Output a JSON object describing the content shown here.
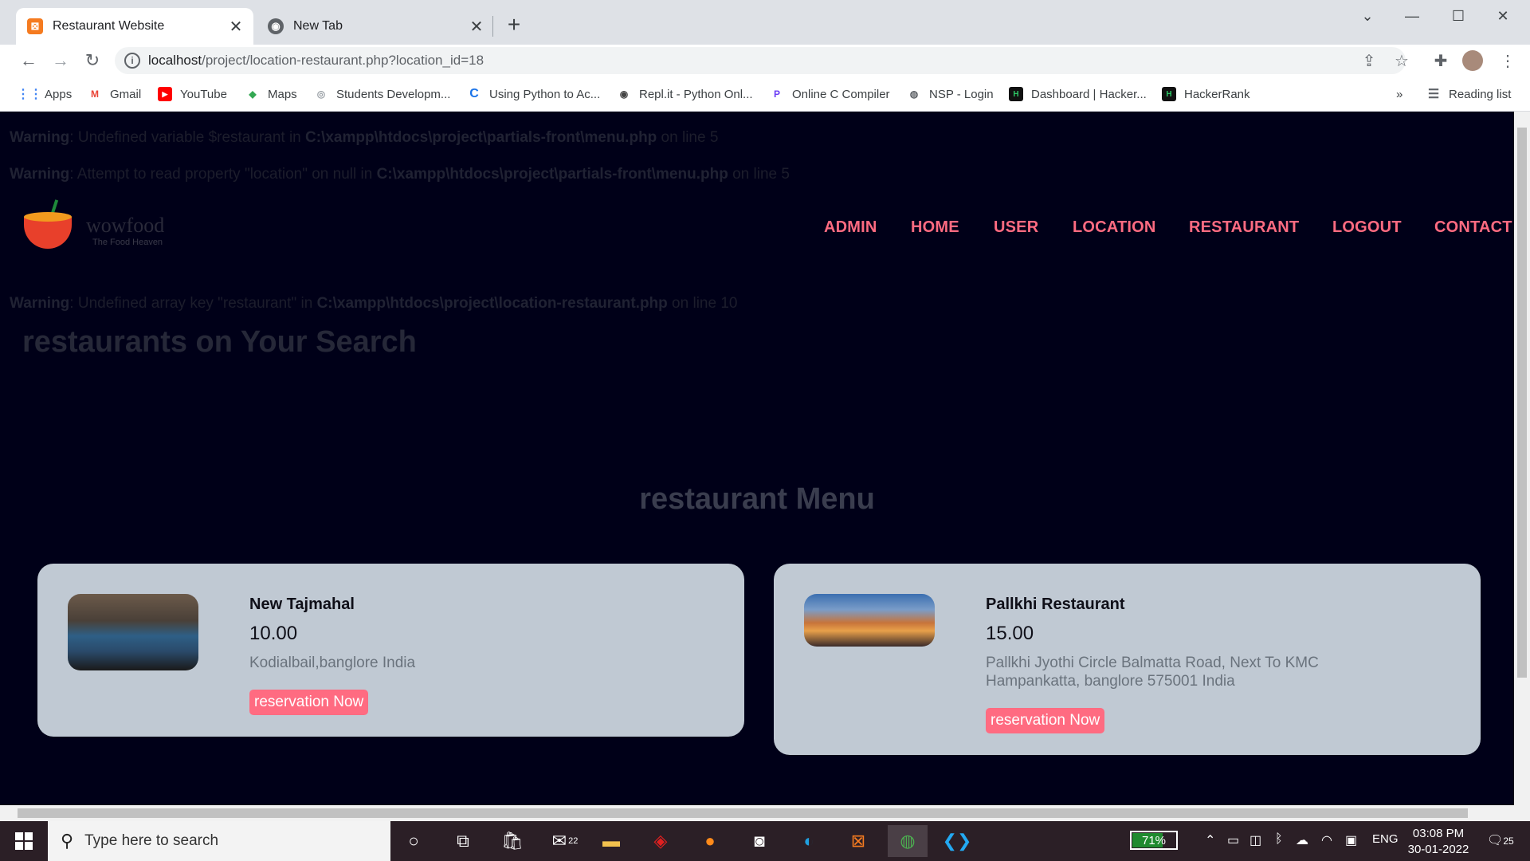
{
  "browser": {
    "tabs": [
      {
        "title": "Restaurant Website",
        "icon": "xampp-icon",
        "active": true
      },
      {
        "title": "New Tab",
        "icon": "globe-icon",
        "active": false
      }
    ],
    "url_host": "localhost",
    "url_path": "/project/location-restaurant.php?location_id=18",
    "bookmarks": [
      "Apps",
      "Gmail",
      "YouTube",
      "Maps",
      "Students Developm...",
      "Using Python to Ac...",
      "Repl.it - Python Onl...",
      "Online C Compiler",
      "NSP - Login",
      "Dashboard | Hacker...",
      "HackerRank"
    ],
    "reading_list": "Reading list",
    "more_bookmarks": "»"
  },
  "page": {
    "logo": {
      "brand": "wowfood",
      "tagline": "The Food Heaven"
    },
    "nav": [
      "ADMIN",
      "HOME",
      "USER",
      "LOCATION",
      "RESTAURANT",
      "LOGOUT",
      "CONTACT"
    ],
    "warnings": [
      {
        "label": "Warning",
        "text": ": Undefined variable $restaurant in ",
        "file": "C:\\xampp\\htdocs\\project\\partials-front\\menu.php",
        "line": " on line 5"
      },
      {
        "label": "Warning",
        "text": ": Attempt to read property \"location\" on null in ",
        "file": "C:\\xampp\\htdocs\\project\\partials-front\\menu.php",
        "line": " on line 5"
      },
      {
        "label": "Warning",
        "text": ": Undefined array key \"restaurant\" in ",
        "file": "C:\\xampp\\htdocs\\project\\location-restaurant.php",
        "line": " on line 10"
      }
    ],
    "search_heading": "restaurants on Your Search",
    "menu_heading": "restaurant Menu",
    "restaurants": [
      {
        "name": "New Tajmahal",
        "price": "10.00",
        "address": "Kodialbail,banglore India",
        "button": "reservation Now"
      },
      {
        "name": "Pallkhi Restaurant",
        "price": "15.00",
        "address": "Pallkhi Jyothi Circle Balmatta Road, Next To KMC Hampankatta, banglore 575001 India",
        "button": "reservation Now"
      }
    ]
  },
  "taskbar": {
    "search_placeholder": "Type here to search",
    "mail_badge": "22",
    "battery": "71%",
    "battery_level": 0.71,
    "language": "ENG",
    "time": "03:08 PM",
    "date": "30-01-2022",
    "notifications": "25"
  },
  "colors": {
    "accent": "#ff6b81",
    "page_bg": "#000018",
    "card_bg": "#c0c9d3"
  }
}
